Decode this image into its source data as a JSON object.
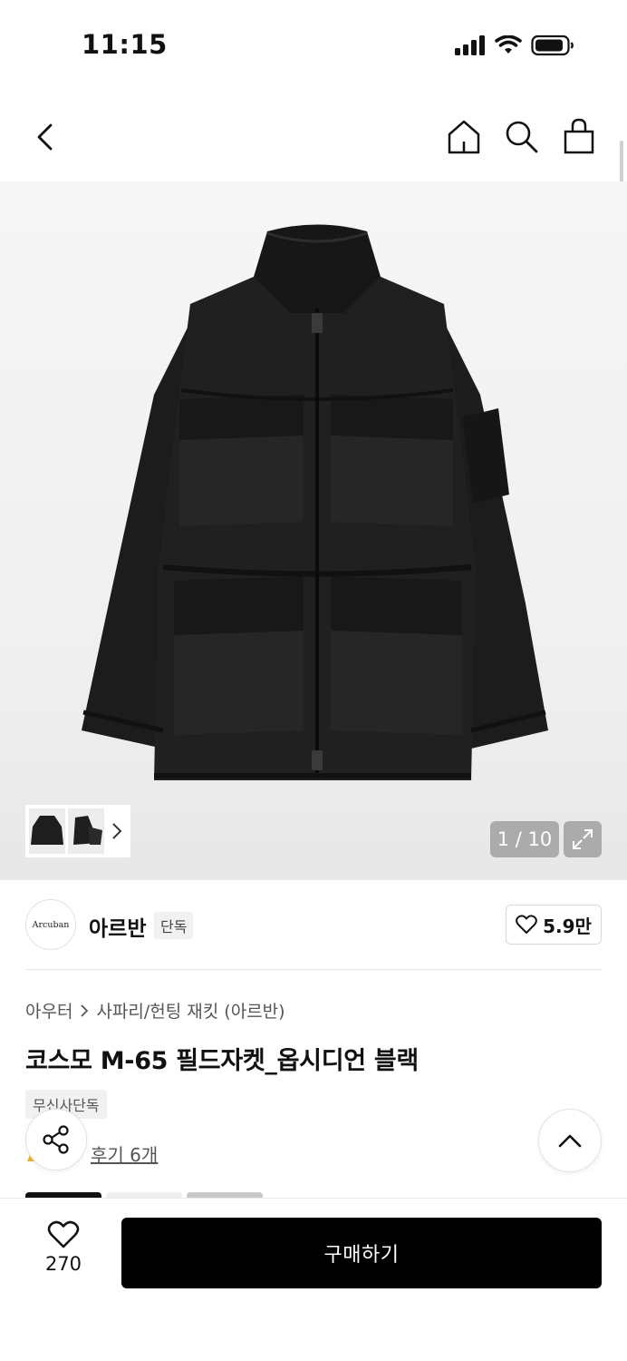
{
  "status_bar": {
    "time": "11:15"
  },
  "header": {
    "icons": [
      "back-icon",
      "home-icon",
      "search-icon",
      "bag-icon"
    ]
  },
  "gallery": {
    "counter": "1 / 10"
  },
  "brand": {
    "logo_text": "Arcuban",
    "name": "아르반",
    "badge": "단독",
    "like_count": "5.9만"
  },
  "breadcrumb": {
    "category": "아우터",
    "subcategory": "사파리/헌팅 재킷 (아르반)"
  },
  "product": {
    "title": "코스모 M-65 필드자켓_옵시디언 블랙",
    "tag": "무신사단독",
    "reviews": "후기 6개"
  },
  "bottom_bar": {
    "wish_count": "270",
    "buy_label": "구매하기"
  },
  "colors": {
    "primary": "#000000",
    "background": "#ffffff",
    "muted_text": "#555555"
  }
}
